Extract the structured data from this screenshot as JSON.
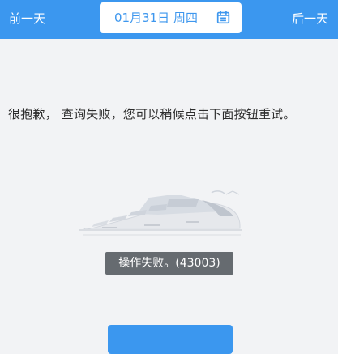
{
  "header": {
    "prev_day_label": "前一天",
    "date_label": "01月31日 周四",
    "next_day_label": "后一天",
    "calendar_icon": "calendar-icon"
  },
  "main": {
    "message_text": "很抱歉， 查询失败，您可以稍候点击下面按钮重试。",
    "toast_text": "操作失败。(43003)"
  },
  "colors": {
    "accent": "#3b97ef",
    "toast_bg": "#666b70",
    "page_bg": "#f2f3f5"
  }
}
